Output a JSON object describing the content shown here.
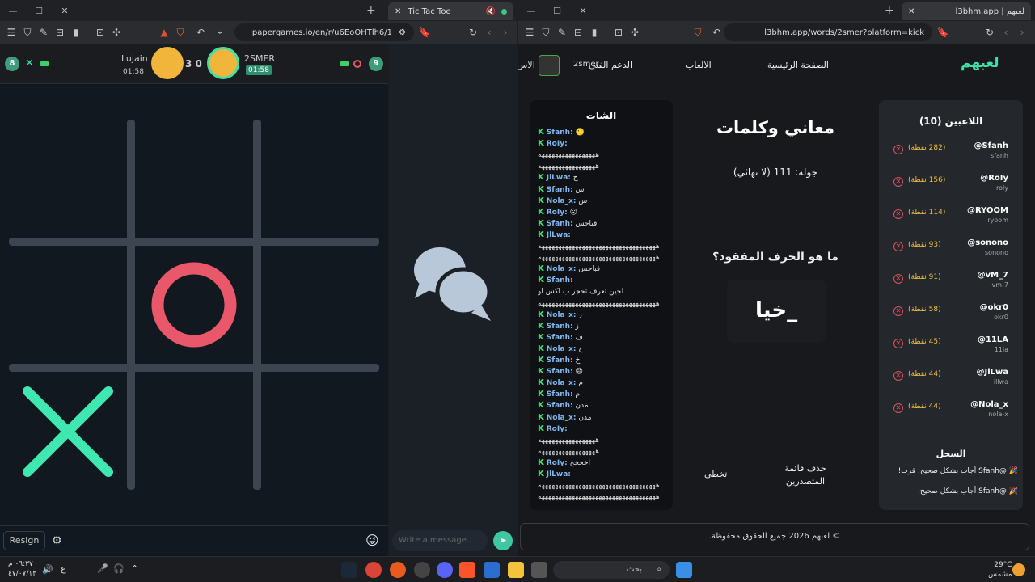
{
  "left_window": {
    "tab_title": "Tic Tac Toe",
    "url": "papergames.io/en/r/u6EoOHTlh6/1",
    "game": {
      "player1": {
        "name": "Lujain",
        "time": "01:58",
        "score": "8"
      },
      "player2": {
        "name": "2SMER",
        "time": "01:58",
        "score": "9"
      },
      "match_score": "3 0"
    },
    "resign_label": "Resign",
    "message_placeholder": "Write a message..."
  },
  "right_window": {
    "tab_title": "l3bhm.app | لعبهم",
    "url": "l3bhm.app/words/2smer?platform=kick",
    "nav": {
      "logo": "لعبهم",
      "home": "الصفحة الرئيسية",
      "games": "الالعاب",
      "support": "الدعم الفني",
      "user": "2smer",
      "cut": "الاس"
    },
    "chat": {
      "title": "الشات",
      "messages": [
        {
          "user": "Sfanh:",
          "text": "🙂"
        },
        {
          "user": "RoIy:",
          "text": ""
        },
        {
          "user": "",
          "text": "هههههههههههههههههه"
        },
        {
          "user": "",
          "text": "هههههههههههههههههه"
        },
        {
          "user": "JlLwa:",
          "text": "ح"
        },
        {
          "user": "Sfanh:",
          "text": "س"
        },
        {
          "user": "Nola_x:",
          "text": "س"
        },
        {
          "user": "RoIy:",
          "text": "😮"
        },
        {
          "user": "Sfanh:",
          "text": "قباحس"
        },
        {
          "user": "JlLwa:",
          "text": ""
        },
        {
          "user": "",
          "text": "هههههههههههههههههههههههههههههههههههه"
        },
        {
          "user": "",
          "text": "هههههههههههههههههههههههههههههههههههه"
        },
        {
          "user": "Nola_x:",
          "text": "قباحس"
        },
        {
          "user": "Sfanh:",
          "text": ""
        },
        {
          "user": "",
          "text": "لجين تعرف تحجر ب اكس او"
        },
        {
          "user": "",
          "text": "هههههههههههههههههههههههههههههههههههه"
        },
        {
          "user": "Nola_x:",
          "text": "ز"
        },
        {
          "user": "Sfanh:",
          "text": "ز"
        },
        {
          "user": "Sfanh:",
          "text": "ف"
        },
        {
          "user": "Nola_x:",
          "text": "خ"
        },
        {
          "user": "Sfanh:",
          "text": "خ"
        },
        {
          "user": "Sfanh:",
          "text": "😃"
        },
        {
          "user": "Nola_x:",
          "text": "م"
        },
        {
          "user": "Sfanh:",
          "text": "م"
        },
        {
          "user": "Sfanh:",
          "text": "مدن"
        },
        {
          "user": "Nola_x:",
          "text": "مدن"
        },
        {
          "user": "RoIy:",
          "text": ""
        },
        {
          "user": "",
          "text": "هههههههههههههههههه"
        },
        {
          "user": "",
          "text": "هههههههههههههههههه"
        },
        {
          "user": "RoIy:",
          "text": "اخخخخ"
        },
        {
          "user": "JlLwa:",
          "text": ""
        },
        {
          "user": "",
          "text": "هههههههههههههههههههههههههههههههههههه"
        },
        {
          "user": "",
          "text": "هههههههههههههههههههههههههههههههههههه"
        }
      ]
    },
    "game": {
      "title": "معاني وكلمات",
      "round": "جولة: 111 (لا نهائي)",
      "question": "ما هو الحرف المفقود؟",
      "word": "خيا_",
      "skip": "تخطي",
      "clear_leaderboard": "حذف قائمة المتصدرين"
    },
    "players": {
      "title": "اللاعبين (10)",
      "list": [
        {
          "handle": "@Sfanh",
          "user": "sfanh",
          "points": "(282 نقطة)"
        },
        {
          "handle": "@RoIy",
          "user": "roly",
          "points": "(156 نقطة)"
        },
        {
          "handle": "@RYOOM",
          "user": "ryoom",
          "points": "(114 نقطة)"
        },
        {
          "handle": "@sonono",
          "user": "sonono",
          "points": "(93 نقطة)"
        },
        {
          "handle": "@vM_7",
          "user": "vm-7",
          "points": "(91 نقطة)"
        },
        {
          "handle": "@okr0",
          "user": "okr0",
          "points": "(58 نقطة)"
        },
        {
          "handle": "@11LA",
          "user": "11la",
          "points": "(45 نقطة)"
        },
        {
          "handle": "@JlLwa",
          "user": "illwa",
          "points": "(44 نقطة)"
        },
        {
          "handle": "@Nola_x",
          "user": "nola-x",
          "points": "(44 نقطة)"
        }
      ]
    },
    "log": {
      "title": "السجل",
      "entries": [
        "🎉 @Sfanh أجاب بشكل صحيح: قرب!",
        "🎉 @Sfanh أجاب بشكل صحيح:"
      ]
    },
    "footer": "© لعبهم 2026 جميع الحقوق محفوظة."
  },
  "taskbar": {
    "search_placeholder": "بحث",
    "time": "٠٦:٣٧ م",
    "date": "٤٧/٠٧/١٣",
    "lang": "ع",
    "weather_temp": "29°C",
    "weather_desc": "مشمس"
  },
  "colors": {
    "accent_green": "#3ee0a8",
    "o_color": "#e9576b",
    "x_color": "#3ee8b0"
  }
}
